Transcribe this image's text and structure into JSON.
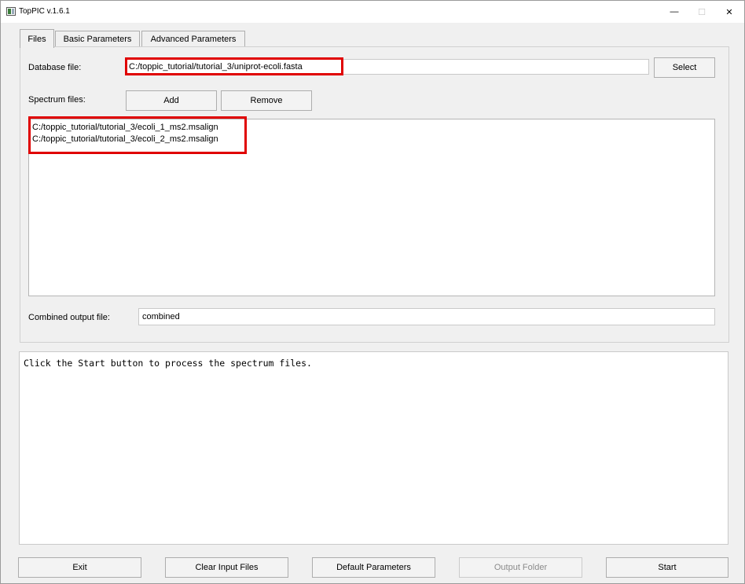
{
  "window": {
    "title": "TopPIC v.1.6.1",
    "controls": {
      "minimize": "—",
      "maximize": "☐",
      "close": "✕"
    }
  },
  "tabs": [
    {
      "label": "Files",
      "active": true
    },
    {
      "label": "Basic Parameters",
      "active": false
    },
    {
      "label": "Advanced Parameters",
      "active": false
    }
  ],
  "files": {
    "database_label": "Database file:",
    "database_value": "C:/toppic_tutorial/tutorial_3/uniprot-ecoli.fasta",
    "select_label": "Select",
    "spectrum_label": "Spectrum files:",
    "add_label": "Add",
    "remove_label": "Remove",
    "spectrum_files": [
      "C:/toppic_tutorial/tutorial_3/ecoli_1_ms2.msalign",
      "C:/toppic_tutorial/tutorial_3/ecoli_2_ms2.msalign"
    ],
    "combined_label": "Combined output file:",
    "combined_value": "combined"
  },
  "console": {
    "text": "Click the Start button to process the spectrum files."
  },
  "bottom_buttons": {
    "exit": "Exit",
    "clear": "Clear Input Files",
    "defaults": "Default Parameters",
    "output_folder": "Output Folder",
    "start": "Start"
  },
  "colors": {
    "highlight": "#e00000",
    "window_bg": "#f0f0f0",
    "disabled_text": "#8b8b8b"
  }
}
